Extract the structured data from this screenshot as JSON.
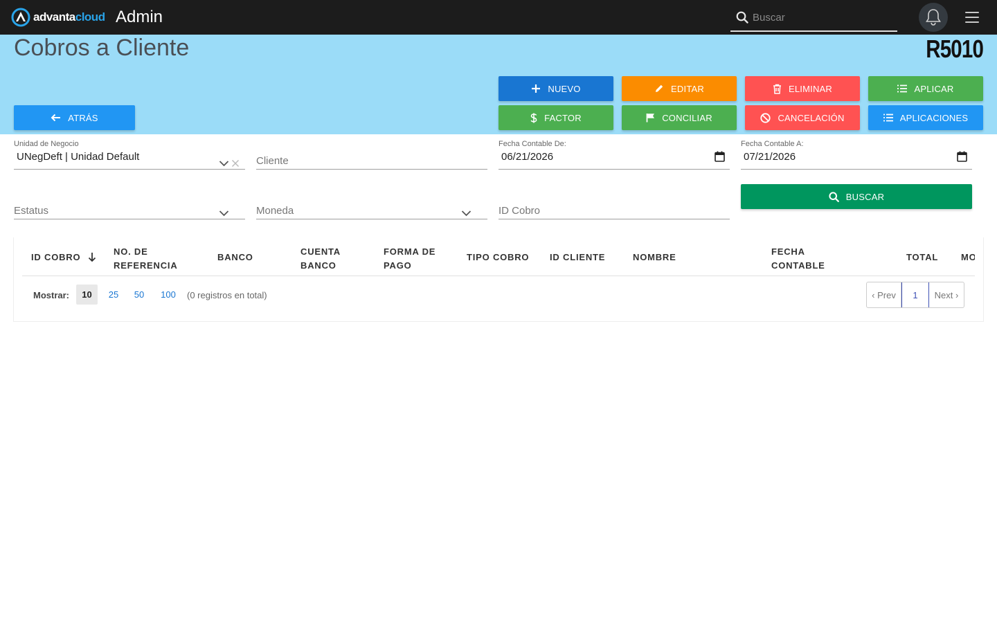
{
  "header": {
    "logo_part1": "advanta",
    "logo_part2": "cloud",
    "app_title": "Admin",
    "search_placeholder": "Buscar"
  },
  "page": {
    "title": "Cobros a Cliente",
    "code": "R5010"
  },
  "buttons": {
    "back": "ATRÁS",
    "nuevo": "NUEVO",
    "editar": "EDITAR",
    "eliminar": "ELIMINAR",
    "aplicar": "APLICAR",
    "factor": "FACTOR",
    "conciliar": "CONCILIAR",
    "cancelacion": "CANCELACIÓN",
    "aplicaciones": "APLICACIONES",
    "buscar": "BUSCAR"
  },
  "filters": {
    "unidad_label": "Unidad de Negocio",
    "unidad_value": "UNegDeft | Unidad Default",
    "cliente_placeholder": "Cliente",
    "fecha_de_label": "Fecha Contable De:",
    "fecha_de_value": "06/21/2026",
    "fecha_a_label": "Fecha Contable A:",
    "fecha_a_value": "07/21/2026",
    "estatus_placeholder": "Estatus",
    "moneda_placeholder": "Moneda",
    "id_cobro_placeholder": "ID Cobro"
  },
  "table": {
    "columns": [
      {
        "line1": "ID COBRO",
        "line2": ""
      },
      {
        "line1": "NO. DE",
        "line2": "REFERENCIA"
      },
      {
        "line1": "BANCO",
        "line2": ""
      },
      {
        "line1": "CUENTA",
        "line2": "BANCO"
      },
      {
        "line1": "FORMA DE",
        "line2": "PAGO"
      },
      {
        "line1": "TIPO COBRO",
        "line2": ""
      },
      {
        "line1": "ID CLIENTE",
        "line2": ""
      },
      {
        "line1": "NOMBRE",
        "line2": ""
      },
      {
        "line1": "FECHA",
        "line2": "CONTABLE"
      },
      {
        "line1": "TOTAL",
        "line2": ""
      },
      {
        "line1": "MO",
        "line2": ""
      }
    ],
    "show_label": "Mostrar:",
    "page_sizes": [
      "10",
      "25",
      "50",
      "100"
    ],
    "active_page_size": "10",
    "total_text": "(0 registros en total)",
    "pager": {
      "prev": "‹ Prev",
      "current": "1",
      "next": "Next ›"
    }
  },
  "colors": {
    "topbar": "#1c1c1c",
    "band": "#9bdcf8",
    "nuevo": "#1976d2",
    "editar": "#fb8c00",
    "eliminar": "#ff5252",
    "aplicar": "#4caf50",
    "aplicaciones": "#2196f3",
    "buscar": "#00965e"
  }
}
